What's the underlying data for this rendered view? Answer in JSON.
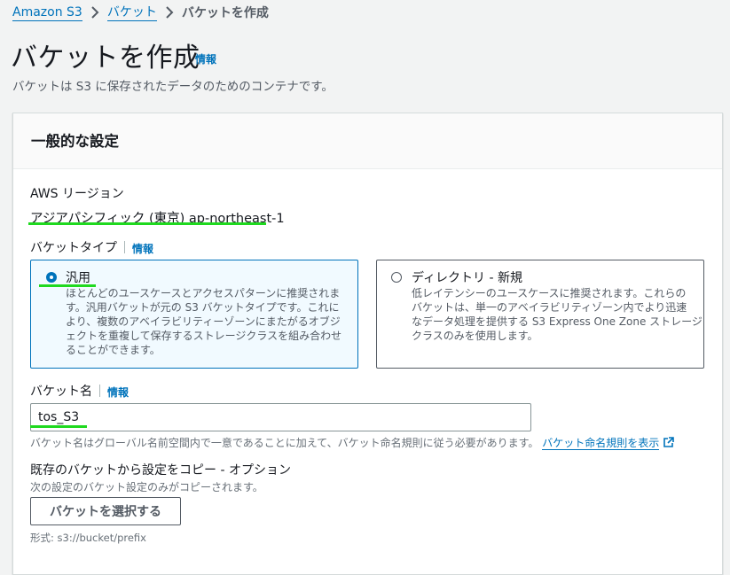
{
  "breadcrumb": {
    "items": [
      {
        "label": "Amazon S3"
      },
      {
        "label": "バケット"
      }
    ],
    "current": "バケットを作成"
  },
  "page": {
    "title": "バケットを作成",
    "info": "情報",
    "description": "バケットは S3 に保存されたデータのためのコンテナです。"
  },
  "general": {
    "title": "一般的な設定",
    "region_label": "AWS リージョン",
    "region_value": "アジアパシフィック (東京) ap-northeast-1",
    "bucket_type_label": "バケットタイプ",
    "bucket_type_info": "情報",
    "types": [
      {
        "title": "汎用",
        "selected": true,
        "description": "ほとんどのユースケースとアクセスパターンに推奨されま\nす。汎用バケットが元の S3 バケットタイプです。これに\nより、複数のアベイラビリティーゾーンにまたがるオブジ\nェクトを重複して保存するストレージクラスを組み合わせ\nることができます。"
      },
      {
        "title": "ディレクトリ - 新規",
        "selected": false,
        "description": "低レイテンシーのユースケースに推奨されます。これらの\nバケットは、単一のアベイラビリティゾーン内でより迅速\nなデータ処理を提供する S3 Express One Zone ストレージ\nクラスのみを使用します。"
      }
    ],
    "bucket_name_label": "バケット名",
    "bucket_name_info": "情報",
    "bucket_name_value": "tos_S3",
    "bucket_name_hint": "バケット名はグローバル名前空間内で一意であることに加えて、バケット命名規則に従う必要があります。",
    "naming_rules_link": "バケット命名規則を表示",
    "copy_title": "既存のバケットから設定をコピー - オプション",
    "copy_desc": "次の設定のバケット設定のみがコピーされます。",
    "choose_bucket_button": "バケットを選択する",
    "format_hint": "形式: s3://bucket/prefix"
  },
  "colors": {
    "link": "#0073bb",
    "annotation_underline": "#1fd91f",
    "selected_tile_bg": "#f1faff"
  },
  "icons": [
    "chevron-right-icon",
    "radio-selected-icon",
    "radio-unselected-icon",
    "external-link-icon"
  ]
}
